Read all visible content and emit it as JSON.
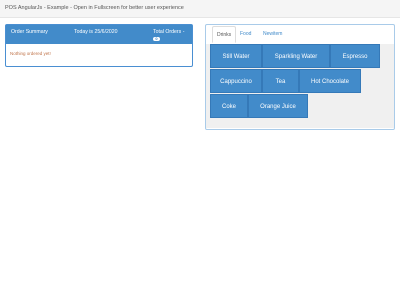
{
  "header": {
    "title": "POS AngularJs - Example - Open in Fullscreen for better user experience"
  },
  "order_summary": {
    "title": "Order Summary",
    "date_label": "Today is 25/6/2020",
    "total_label": "Total Orders -",
    "total_count": "0",
    "empty_message": "Nothing ordered yet!"
  },
  "menu": {
    "tabs": [
      {
        "label": "Drinks",
        "active": true
      },
      {
        "label": "Food",
        "active": false
      },
      {
        "label": "Newitem",
        "active": false
      }
    ],
    "items": [
      {
        "label": "Still Water"
      },
      {
        "label": "Sparkling Water"
      },
      {
        "label": "Espresso"
      },
      {
        "label": "Cappuccino"
      },
      {
        "label": "Tea"
      },
      {
        "label": "Hot Chocolate"
      },
      {
        "label": "Coke"
      },
      {
        "label": "Orange Juice"
      }
    ]
  },
  "colors": {
    "primary": "#428bca",
    "panel_border": "#a9cbe9",
    "empty_text": "#c0744a"
  }
}
